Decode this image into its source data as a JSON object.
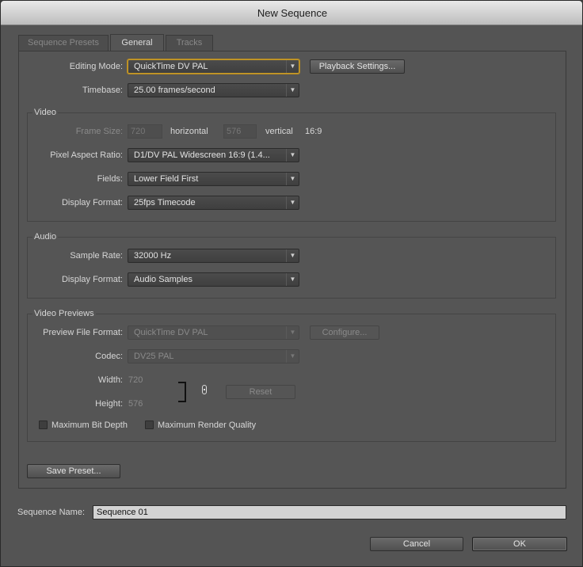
{
  "window": {
    "title": "New Sequence"
  },
  "tabs": [
    {
      "label": "Sequence Presets",
      "active": false
    },
    {
      "label": "General",
      "active": true
    },
    {
      "label": "Tracks",
      "active": false
    }
  ],
  "general": {
    "editing_mode": {
      "label": "Editing Mode:",
      "value": "QuickTime DV PAL"
    },
    "playback_settings_label": "Playback Settings...",
    "timebase": {
      "label": "Timebase:",
      "value": "25.00 frames/second"
    }
  },
  "video": {
    "title": "Video",
    "frame_size": {
      "label": "Frame Size:",
      "width": "720",
      "horizontal": "horizontal",
      "height": "576",
      "vertical": "vertical",
      "aspect": "16:9"
    },
    "pixel_aspect_ratio": {
      "label": "Pixel Aspect Ratio:",
      "value": "D1/DV PAL Widescreen 16:9 (1.4..."
    },
    "fields": {
      "label": "Fields:",
      "value": "Lower Field First"
    },
    "display_format": {
      "label": "Display Format:",
      "value": "25fps Timecode"
    }
  },
  "audio": {
    "title": "Audio",
    "sample_rate": {
      "label": "Sample Rate:",
      "value": "32000 Hz"
    },
    "display_format": {
      "label": "Display Format:",
      "value": "Audio Samples"
    }
  },
  "previews": {
    "title": "Video Previews",
    "file_format": {
      "label": "Preview File Format:",
      "value": "QuickTime DV PAL"
    },
    "configure_label": "Configure...",
    "codec": {
      "label": "Codec:",
      "value": "DV25 PAL"
    },
    "width": {
      "label": "Width:",
      "value": "720"
    },
    "height": {
      "label": "Height:",
      "value": "576"
    },
    "reset_label": "Reset",
    "max_bit_depth": "Maximum Bit Depth",
    "max_render_quality": "Maximum Render Quality"
  },
  "save_preset_label": "Save Preset...",
  "sequence_name": {
    "label": "Sequence Name:",
    "value": "Sequence 01"
  },
  "buttons": {
    "cancel": "Cancel",
    "ok": "OK"
  },
  "icons": {
    "dropdown": "▼",
    "link": "chain-link-icon"
  },
  "colors": {
    "focus_ring": "#c49a2c",
    "window_bg": "#545454"
  }
}
